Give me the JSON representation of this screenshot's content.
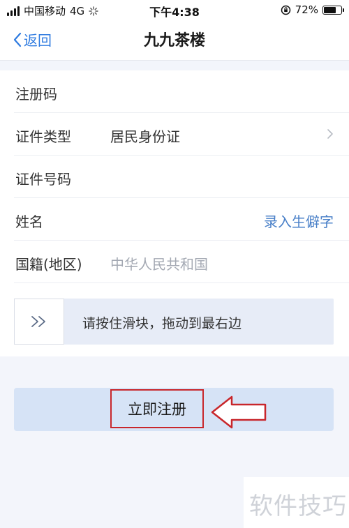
{
  "status_bar": {
    "carrier": "中国移动",
    "network": "4G",
    "time": "下午4:38",
    "battery": "72%",
    "battery_level": 0.72
  },
  "nav": {
    "back_label": "返回",
    "title": "九九茶楼"
  },
  "form": {
    "rows": [
      {
        "label": "注册码"
      },
      {
        "label": "证件类型",
        "value": "居民身份证"
      },
      {
        "label": "证件号码"
      },
      {
        "label": "姓名",
        "link": "录入生僻字"
      },
      {
        "label": "国籍(地区)",
        "placeholder": "中华人民共和国"
      }
    ]
  },
  "slider": {
    "handle_glyph": ">>",
    "hint": "请按住滑块，拖动到最右边"
  },
  "register_button": {
    "label": "立即注册"
  },
  "watermark": {
    "text": "软件技巧"
  },
  "colors": {
    "accent": "#2f7be0",
    "annotation": "#c8262b",
    "button_bg": "#d6e3f6"
  }
}
